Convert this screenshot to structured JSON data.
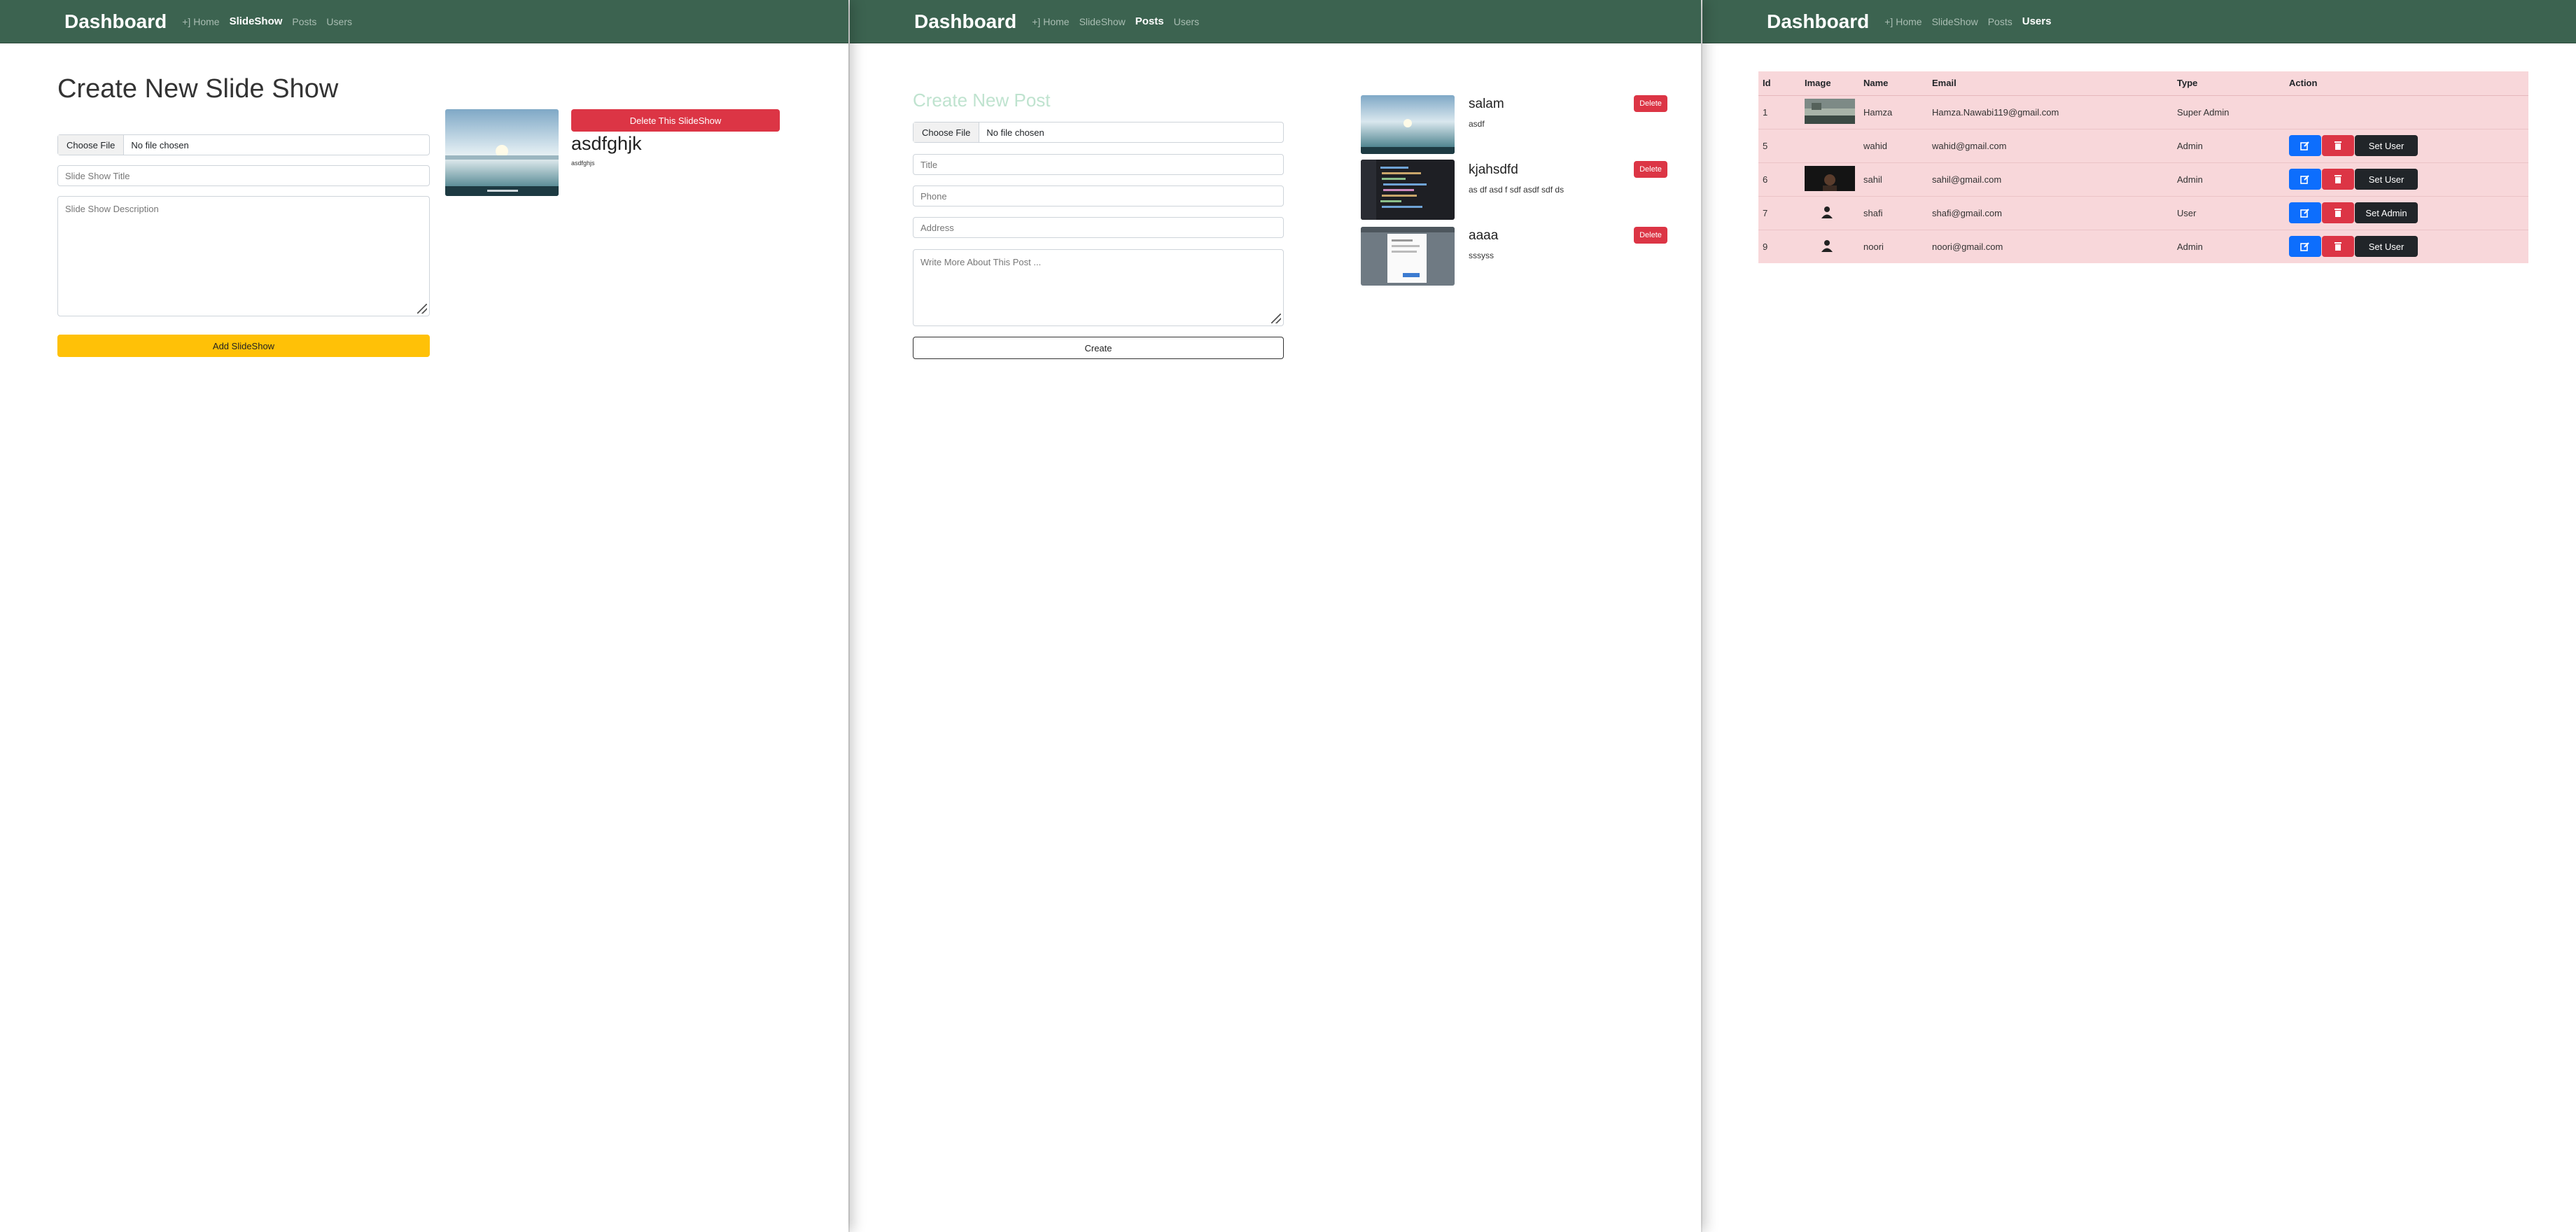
{
  "nav": {
    "brand": "Dashboard",
    "home": "+] Home",
    "slideshow": "SlideShow",
    "posts": "Posts",
    "users": "Users"
  },
  "slideshow_page": {
    "title": "Create New Slide Show",
    "choose_file": "Choose File",
    "no_file": "No file chosen",
    "title_placeholder": "Slide Show Title",
    "desc_placeholder": "Slide Show Description",
    "add_button": "Add SlideShow",
    "delete_button": "Delete This SlideShow",
    "slide_title": "asdfghjk",
    "slide_desc": "asdfghjs"
  },
  "posts_page": {
    "title": "Create New Post",
    "choose_file": "Choose File",
    "no_file": "No file chosen",
    "title_placeholder": "Title",
    "phone_placeholder": "Phone",
    "address_placeholder": "Address",
    "about_placeholder": "Write More About This Post ...",
    "create_button": "Create",
    "delete_label": "Delete",
    "posts": [
      {
        "title": "salam",
        "body": "asdf"
      },
      {
        "title": "kjahsdfd",
        "body": "as df asd f sdf asdf sdf ds"
      },
      {
        "title": "aaaa",
        "body": "sssyss"
      }
    ]
  },
  "users_page": {
    "headers": [
      "Id",
      "Image",
      "Name",
      "Email",
      "Type",
      "Action"
    ],
    "rows": [
      {
        "id": "1",
        "name": "Hamza",
        "email": "Hamza.Nawabi119@gmail.com",
        "type": "Super Admin",
        "image": "photo-landscape",
        "role_button": ""
      },
      {
        "id": "5",
        "name": "wahid",
        "email": "wahid@gmail.com",
        "type": "Admin",
        "image": "none",
        "role_button": "Set User"
      },
      {
        "id": "6",
        "name": "sahil",
        "email": "sahil@gmail.com",
        "type": "Admin",
        "image": "photo-dark",
        "role_button": "Set User"
      },
      {
        "id": "7",
        "name": "shafi",
        "email": "shafi@gmail.com",
        "type": "User",
        "image": "person-icon",
        "role_button": "Set Admin"
      },
      {
        "id": "9",
        "name": "noori",
        "email": "noori@gmail.com",
        "type": "Admin",
        "image": "person-icon",
        "role_button": "Set User"
      }
    ]
  },
  "colors": {
    "navbar": "#3c6350",
    "table_bg": "#f8d7da",
    "danger": "#dc3545",
    "primary": "#0d6efd",
    "warning": "#ffc107",
    "dark": "#212529",
    "post_title": "#bfe3cf"
  }
}
